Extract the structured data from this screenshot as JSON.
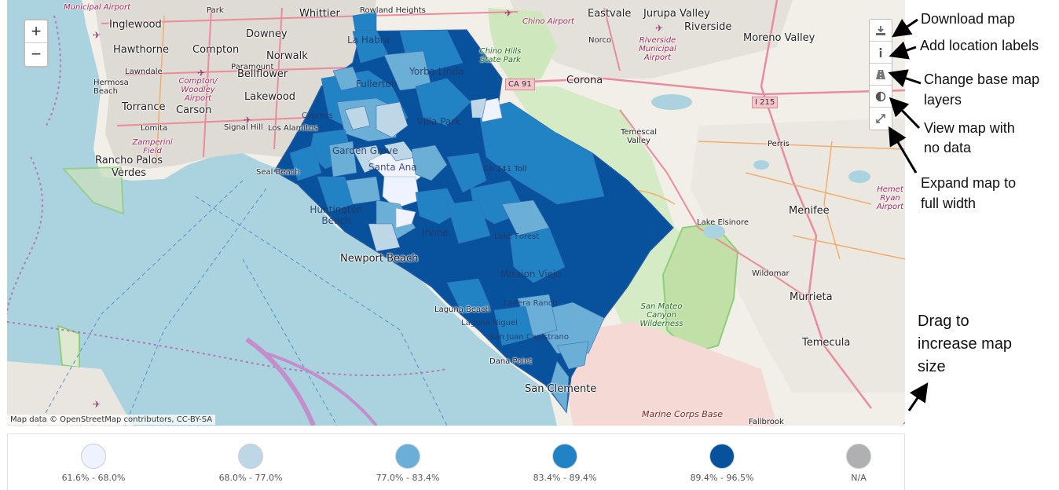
{
  "map": {
    "zoom_in_label": "+",
    "zoom_out_label": "−",
    "attribution": "Map data © OpenStreetMap contributors, CC-BY-SA",
    "places": {
      "inglewood": "Inglewood",
      "hawthorne": "Hawthorne",
      "downey": "Downey",
      "whittier": "Whittier",
      "rowland_heights": "Rowland Heights",
      "eastvale": "Eastvale",
      "jurupa_valley": "Jurupa Valley",
      "riverside": "Riverside",
      "moreno_valley": "Moreno Valley",
      "compton": "Compton",
      "norwalk": "Norwalk",
      "lawndale": "Lawndale",
      "bellflower": "Bellflower",
      "hermosa_beach": "Hermosa Beach",
      "lakewood": "Lakewood",
      "torrance": "Torrance",
      "carson": "Carson",
      "lomita": "Lomita",
      "signal_hill": "Signal Hill",
      "los_alamitos": "Los Alamitos",
      "rancho_palos_verdes": "Rancho Palos Verdes",
      "seal_beach": "Seal Beach",
      "la_habra": "La Habra",
      "yorba_linda": "Yorba Linda",
      "fullerton": "Fullerton",
      "cypress": "Cypress",
      "villa_park": "Villa Park",
      "garden_grove": "Garden Grove",
      "santa_ana": "Santa Ana",
      "huntington_beach": "Huntington Beach",
      "irvine": "Irvine",
      "newport_beach": "Newport Beach",
      "lake_forest": "Lake Forest",
      "mission_viejo": "Mission Viejo",
      "ladera_ranch": "Ladera Ranch",
      "laguna_beach": "Laguna Beach",
      "laguna_niguel": "Laguna Niguel",
      "san_juan_capistrano": "San Juan Capistrano",
      "dana_point": "Dana Point",
      "san_clemente": "San Clemente",
      "corona": "Corona",
      "norco": "Norco",
      "temescal_valley": "Temescal Valley",
      "perris": "Perris",
      "menifee": "Menifee",
      "lake_elsinore": "Lake Elsinore",
      "wildomar": "Wildomar",
      "murrieta": "Murrieta",
      "temecula": "Temecula",
      "fallbrook": "Fallbrook",
      "paramount": "Paramount",
      "park": "Park",
      "whittier_airport": "Municipal Airport",
      "chino_airport": "Chino Airport",
      "riverside_airport": "Riverside Municipal Airport",
      "compton_airport": "Compton/ Woodley Airport",
      "zamperini_field": "Zamperini Field",
      "chino_hills_park": "Chino Hills State Park",
      "san_mateo_wilderness": "San Mateo Canyon Wilderness",
      "marine_corps_base": "Marine Corps Base",
      "hemet_airport": "Hemet Ryan Airport",
      "ca91": "CA 91",
      "i215": "I 215",
      "ca241": "CA 241 Toll"
    }
  },
  "toolbar": {
    "download_icon": "download-icon",
    "info_icon": "info-icon",
    "layers_icon": "road-icon",
    "contrast_icon": "half-circle-icon",
    "expand_icon": "expand-arrows-icon"
  },
  "annotations": {
    "download_map": "Download map",
    "add_location_labels": "Add location labels",
    "change_base_map_line1": "Change base map",
    "change_base_map_line2": "layers",
    "view_no_data_line1": "View map with",
    "view_no_data_line2": "no data",
    "expand_line1": "Expand map to",
    "expand_line2": "full width",
    "drag_line1": "Drag to",
    "drag_line2": "increase map",
    "drag_line3": "size"
  },
  "legend": {
    "items": [
      {
        "label": "61.6% - 68.0%",
        "color": "#eff3ff"
      },
      {
        "label": "68.0% - 77.0%",
        "color": "#bdd7e7"
      },
      {
        "label": "77.0% - 83.4%",
        "color": "#6baed6"
      },
      {
        "label": "83.4% - 89.4%",
        "color": "#2182c4"
      },
      {
        "label": "89.4% - 96.5%",
        "color": "#08519c"
      },
      {
        "label": "N/A",
        "color": "#b0b0b0"
      }
    ]
  },
  "colors": {
    "water": "#aad3df",
    "land": "#f2efe9",
    "urban": "#e0dcd6",
    "park": "#c8e6b4",
    "county_outline": "#2d5fa0"
  }
}
